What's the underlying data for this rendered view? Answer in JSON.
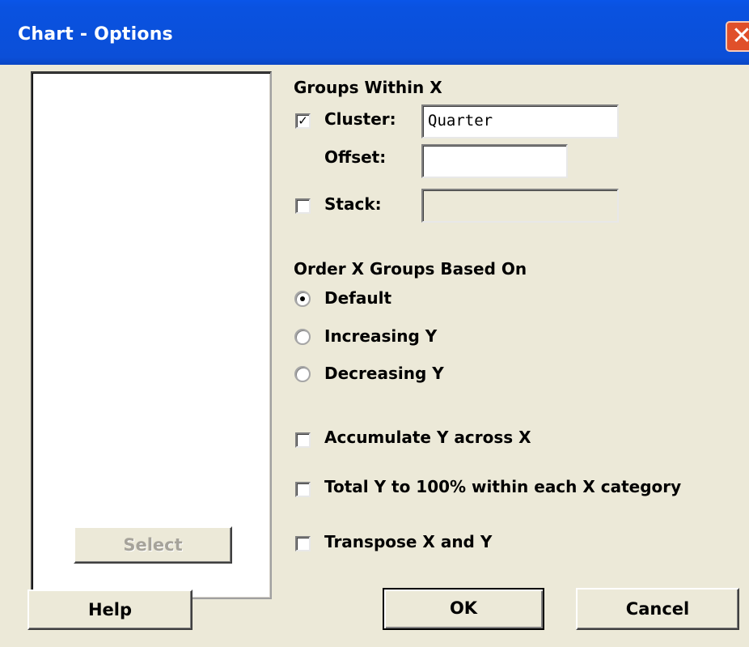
{
  "window": {
    "title": "Chart - Options",
    "close_glyph": "✕"
  },
  "left_panel": {
    "select_label": "Select",
    "help_label": "Help"
  },
  "groups_within_x": {
    "title": "Groups Within X",
    "cluster": {
      "label": "Cluster:",
      "checked": true,
      "value": "Quarter"
    },
    "offset": {
      "label": "Offset:",
      "value": ""
    },
    "stack": {
      "label": "Stack:",
      "checked": false,
      "value": ""
    }
  },
  "order": {
    "title": "Order X Groups Based On",
    "options": [
      {
        "label": "Default",
        "selected": true
      },
      {
        "label": "Increasing Y",
        "selected": false
      },
      {
        "label": "Decreasing Y",
        "selected": false
      }
    ]
  },
  "checkboxes": [
    {
      "label": "Accumulate Y across X",
      "checked": false
    },
    {
      "label": "Total Y to 100% within each X category",
      "checked": false
    },
    {
      "label": "Transpose X and Y",
      "checked": false
    }
  ],
  "buttons": {
    "ok_label": "OK",
    "cancel_label": "Cancel"
  },
  "check_glyph": "✓"
}
